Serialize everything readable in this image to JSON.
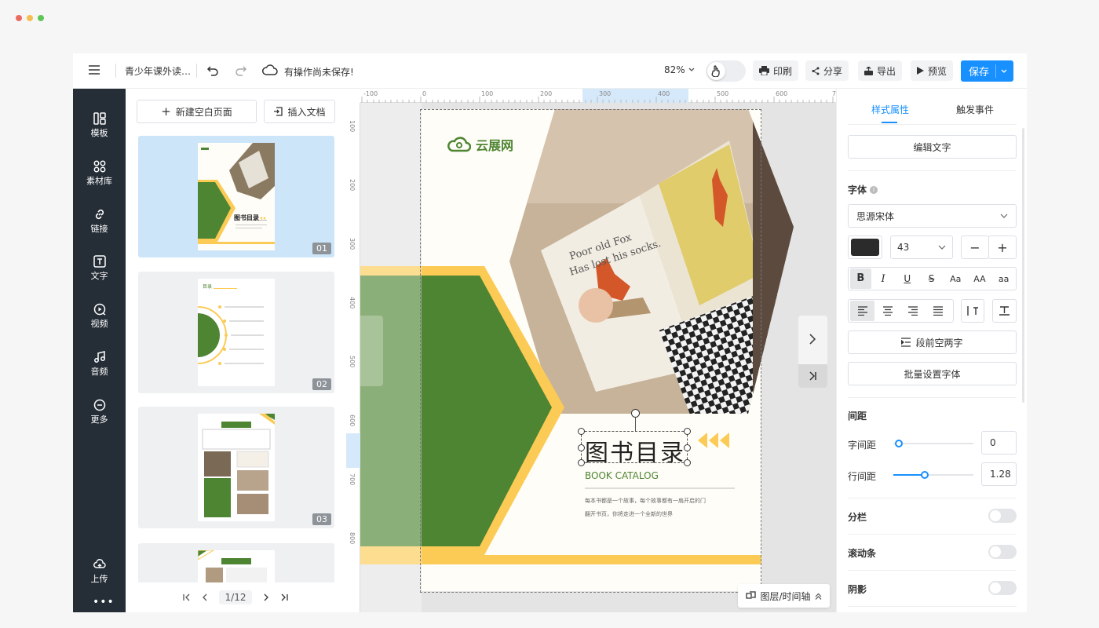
{
  "window": {
    "dot_colors": [
      "#ec6a5e",
      "#f5bf4f",
      "#61c554"
    ]
  },
  "toolbar": {
    "doc_title": "青少年课外读…",
    "unsaved_text": "有操作尚未保存!",
    "zoom": "82%",
    "print_label": "印刷",
    "share_label": "分享",
    "export_label": "导出",
    "preview_label": "预览",
    "save_label": "保存"
  },
  "nav": {
    "items": [
      {
        "label": "模板",
        "icon": "template-icon"
      },
      {
        "label": "素材库",
        "icon": "materials-icon"
      },
      {
        "label": "链接",
        "icon": "link-icon"
      },
      {
        "label": "文字",
        "icon": "text-icon"
      },
      {
        "label": "视频",
        "icon": "video-icon"
      },
      {
        "label": "音频",
        "icon": "music-icon"
      },
      {
        "label": "更多",
        "icon": "more-icon"
      }
    ],
    "upload_label": "上传"
  },
  "pages": {
    "new_page_label": "新建空白页面",
    "insert_doc_label": "插入文档",
    "thumbs": [
      {
        "num": "01",
        "title": "图书目录"
      },
      {
        "num": "02",
        "title": "目录"
      },
      {
        "num": "03",
        "title": ""
      }
    ],
    "pager": "1/12"
  },
  "ruler": {
    "h_ticks": [
      "-100",
      "0",
      "100",
      "200",
      "300",
      "400",
      "500",
      "600",
      "7"
    ],
    "v_ticks": [
      "100",
      "200",
      "300",
      "400",
      "500",
      "600",
      "700",
      "800"
    ]
  },
  "canvas": {
    "logo_text": "云展网",
    "title": "图书目录",
    "subtitle": "BOOK CATALOG",
    "body_line1": "每本书都是一个故事，每个故事都有一扇开启的门",
    "body_line2": "翻开书页，你将走进一个全新的世界",
    "book_text1": "Poor old Fox",
    "book_text2": "Has lost his socks.",
    "layers_label": "图层/时间轴",
    "colors": {
      "green": "#4e8532",
      "yellow": "#fccb55",
      "cream": "#fffdf7"
    }
  },
  "panel": {
    "tab_style": "样式属性",
    "tab_events": "触发事件",
    "edit_text": "编辑文字",
    "font_label": "字体",
    "font_name": "思源宋体",
    "font_size": "43",
    "minus": "−",
    "plus": "+",
    "case_btns": [
      "Aa",
      "AA",
      "aa"
    ],
    "indent_label": "段前空两字",
    "batch_font_label": "批量设置字体",
    "spacing_label": "间距",
    "letter_spacing_label": "字间距",
    "letter_spacing": "0",
    "line_spacing_label": "行间距",
    "line_spacing": "1.28",
    "columns_label": "分栏",
    "scrollbar_label": "滚动条",
    "shadow_label": "阴影",
    "accent": "#1890ff"
  }
}
